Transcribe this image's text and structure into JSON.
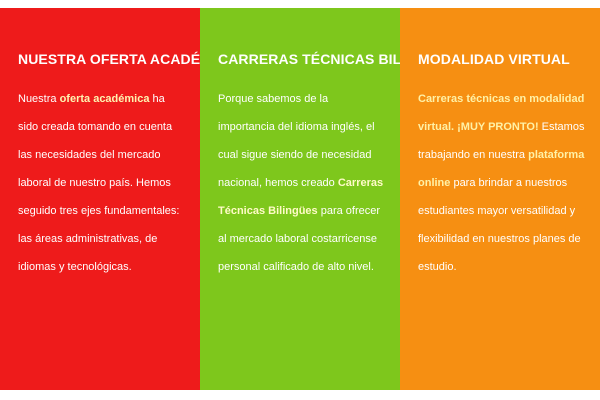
{
  "colors": {
    "red": "#ee1b1b",
    "green": "#7ec71c",
    "orange": "#f68f12",
    "highlight": "#fff3b0"
  },
  "panels": [
    {
      "title": "NUESTRA OFERTA ACADÉMICA",
      "t1": "Nuestra ",
      "b1": "oferta académica",
      "t2": " ha sido creada tomando en cuenta las necesidades del mercado laboral de nuestro país. Hemos seguido tres ejes fundamentales: las áreas administrativas, de idiomas y tecnológicas."
    },
    {
      "title": "CARRERAS TÉCNICAS BILINGÜES",
      "t1": "Porque sabemos de la importancia del idioma inglés, el cual sigue siendo de necesidad nacional, hemos creado ",
      "b1": "Carreras Técnicas Bilingües",
      "t2": " para ofrecer al mercado laboral costarricense personal calificado de alto nivel."
    },
    {
      "title": "MODALIDAD VIRTUAL",
      "b1": "Carreras técnicas en modalidad virtual. ¡MUY PRONTO!",
      "t1": " Estamos trabajando en nuestra ",
      "b2": "plataforma online",
      "t2": " para brindar a nuestros estudiantes mayor versatilidad y flexibilidad en nuestros planes de estudio."
    }
  ]
}
